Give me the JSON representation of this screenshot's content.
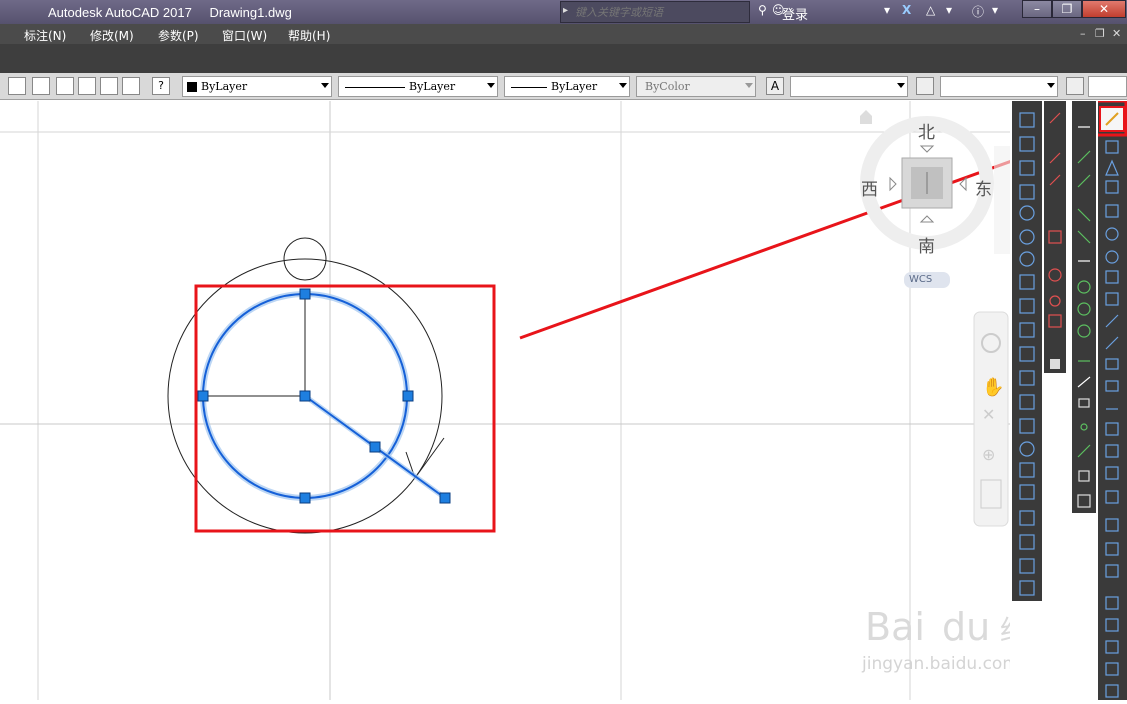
{
  "titlebar": {
    "app": "Autodesk AutoCAD 2017",
    "file": "Drawing1.dwg",
    "search_placeholder": "键入关键字或短语",
    "login": "登录"
  },
  "menubar": {
    "items": [
      "标注(N)",
      "修改(M)",
      "参数(P)",
      "窗口(W)",
      "帮助(H)"
    ]
  },
  "properties": {
    "color": "ByLayer",
    "linetype": "ByLayer",
    "lineweight": "ByLayer",
    "plotstyle": "ByColor"
  },
  "viewcube": {
    "north": "北",
    "south": "南",
    "east": "东",
    "west": "西",
    "wcs": "WCS"
  },
  "watermark": {
    "brand": "Bai",
    "brand2": "du",
    "cn": "经验",
    "url": "jingyan.baidu.com"
  },
  "colors": {
    "selection": "#1560d8",
    "highlight": "#e8141a",
    "grip": "#1e7fe0"
  }
}
